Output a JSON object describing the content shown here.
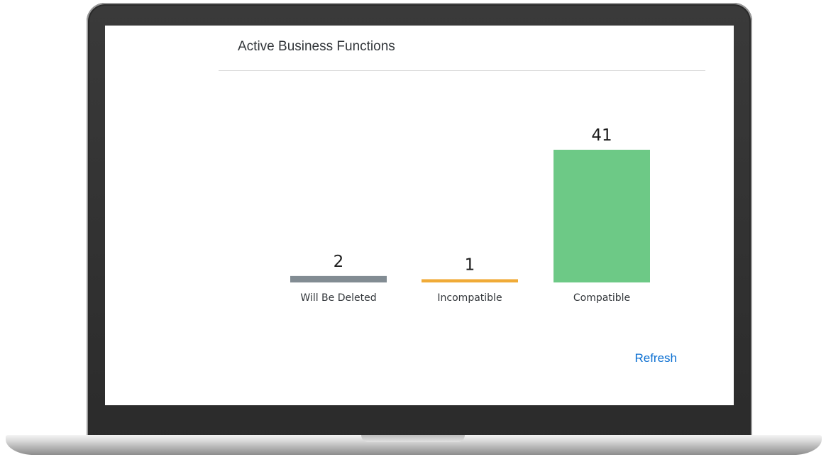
{
  "card": {
    "title": "Active Business Functions",
    "refresh_label": "Refresh"
  },
  "colors": {
    "deleted": "#828c93",
    "incompatible": "#f0ab38",
    "compatible": "#6dc986",
    "link": "#0a6ed1",
    "frame": "#2b2b2b"
  },
  "chart_data": {
    "type": "bar",
    "title": "",
    "xlabel": "",
    "ylabel": "",
    "categories": [
      "Will Be Deleted",
      "Incompatible",
      "Compatible"
    ],
    "values": [
      2,
      1,
      41
    ],
    "ylim": [
      0,
      41
    ],
    "grid": false,
    "data_labels": true
  }
}
